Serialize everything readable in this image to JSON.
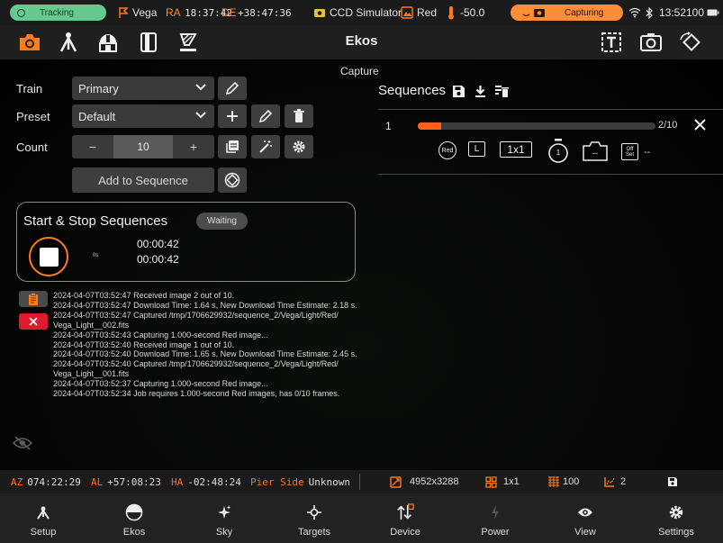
{
  "status": {
    "tracking_label": "Tracking",
    "target": "Vega",
    "ra_label": "RA",
    "ra_value": "18:37:42",
    "de_label": "DE",
    "de_value": "+38:47:36",
    "camera": "CCD Simulator",
    "filter": "Red",
    "temperature": "-50.0",
    "capturing_label": "Capturing",
    "time": "13:52",
    "battery": "100"
  },
  "toolbar": {
    "title": "Ekos",
    "icons": [
      "camera-icon",
      "telescope-tripod-icon",
      "observatory-icon",
      "notebook-icon",
      "focus-icon",
      "text-icon",
      "screenshot-icon",
      "rotate-icon"
    ]
  },
  "capture": {
    "title": "Capture",
    "train_label": "Train",
    "train_value": "Primary",
    "preset_label": "Preset",
    "preset_value": "Default",
    "count_label": "Count",
    "count_minus": "−",
    "count_value": "10",
    "count_plus": "+",
    "add_to_sequence": "Add to Sequence"
  },
  "start_stop": {
    "title": "Start & Stop Sequences",
    "status": "Waiting",
    "elapsed_label": "0s",
    "time_1": "00:00:42",
    "time_2": "00:00:42"
  },
  "log": [
    "2024-04-07T03:52:47 Received image 2 out of 10.",
    "2024-04-07T03:52:47 Download Time: 1.64 s, New Download Time Estimate: 2.18 s.",
    "2024-04-07T03:52:47 Captured /tmp/1706629932/sequence_2/Vega/Light/Red/",
    "Vega_Light__002.fits",
    "2024-04-07T03:52:43 Capturing 1.000-second Red image...",
    "2024-04-07T03:52:40 Received image 1 out of 10.",
    "2024-04-07T03:52:40 Download Time: 1.65 s, New Download Time Estimate: 2.45 s.",
    "2024-04-07T03:52:40 Captured /tmp/1706629932/sequence_2/Vega/Light/Red/",
    "Vega_Light__001.fits",
    "2024-04-07T03:52:37 Capturing 1.000-second Red image...",
    "2024-04-07T03:52:34 Job requires 1.000-second Red images, has 0/10 frames."
  ],
  "sequences": {
    "title": "Sequences",
    "items": [
      {
        "index": "1",
        "progress": 0.1,
        "count": "2/10",
        "filter": "Red",
        "type": "L",
        "binning": "1x1",
        "exposure": "1",
        "gain": "--",
        "offset_label": "Off Set",
        "offset": "--"
      }
    ]
  },
  "info": {
    "az_label": "AZ",
    "az_value": "074:22:29",
    "al_label": "AL",
    "al_value": "+57:08:23",
    "ha_label": "HA",
    "ha_value": "-02:48:24",
    "pier_label": "Pier Side",
    "pier_value": "Unknown",
    "resolution": "4952x3288",
    "binning": "1x1",
    "quality": "100",
    "temp_value": "2"
  },
  "nav": [
    {
      "label": "Setup"
    },
    {
      "label": "Ekos"
    },
    {
      "label": "Sky"
    },
    {
      "label": "Targets"
    },
    {
      "label": "Device"
    },
    {
      "label": "Power"
    },
    {
      "label": "View"
    },
    {
      "label": "Settings"
    }
  ],
  "colors": {
    "accent": "#ff7b1c",
    "tracking": "#66c98d",
    "capturing": "#ff8c36",
    "stop": "#e0192f"
  }
}
